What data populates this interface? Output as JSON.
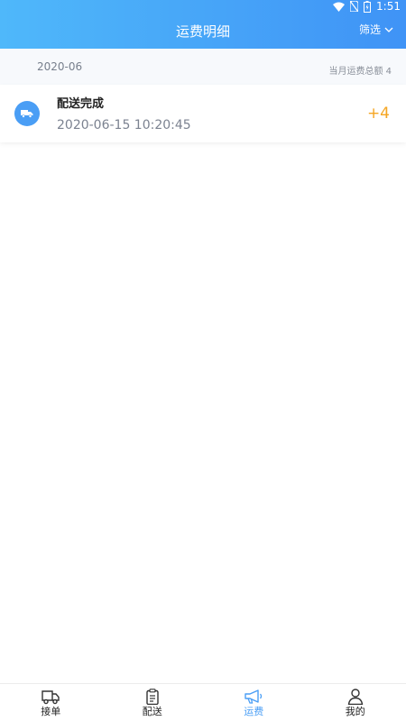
{
  "status_bar": {
    "time": "1:51"
  },
  "header": {
    "title": "运费明细",
    "filter_label": "筛选"
  },
  "summary": {
    "month": "2020-06",
    "total_text": "当月运费总额 4"
  },
  "records": [
    {
      "title": "配送完成",
      "time": "2020-06-15 10:20:45",
      "amount": "+4"
    }
  ],
  "tabs": [
    {
      "label": "接单",
      "icon": "truck-icon",
      "active": false
    },
    {
      "label": "配送",
      "icon": "clipboard-icon",
      "active": false
    },
    {
      "label": "运费",
      "icon": "megaphone-icon",
      "active": true
    },
    {
      "label": "我的",
      "icon": "user-icon",
      "active": false
    }
  ],
  "colors": {
    "header_start": "#4fb8fa",
    "header_end": "#3f93f6",
    "accent": "#4a9ef5",
    "amount": "#f5a623"
  }
}
